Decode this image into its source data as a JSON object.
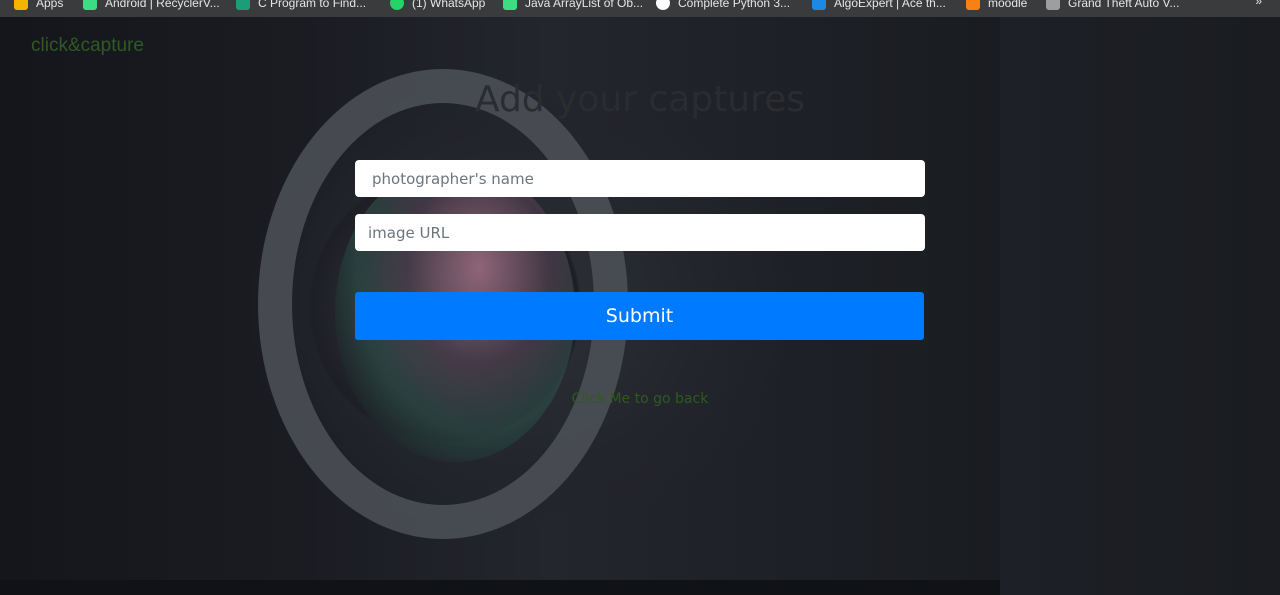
{
  "bookmarks": {
    "items": [
      {
        "label": "Apps",
        "icon": "apps-grid-icon",
        "color": "#f4b400"
      },
      {
        "label": "Android | RecyclerV...",
        "icon": "android-icon",
        "color": "#3ddc84"
      },
      {
        "label": "C Program to Find...",
        "icon": "site-icon",
        "color": "#1b9e77"
      },
      {
        "label": "(1) WhatsApp",
        "icon": "whatsapp-icon",
        "color": "#25d366"
      },
      {
        "label": "Java ArrayList of Ob...",
        "icon": "android-icon",
        "color": "#3ddc84"
      },
      {
        "label": "Complete Python 3...",
        "icon": "github-icon",
        "color": "#ffffff"
      },
      {
        "label": "AlgoExpert | Ace th...",
        "icon": "algoexpert-icon",
        "color": "#1e88e5"
      },
      {
        "label": "moodle",
        "icon": "moodle-icon",
        "color": "#f98012"
      },
      {
        "label": "Grand Theft Auto V...",
        "icon": "gta-icon",
        "color": "#9e9e9e"
      }
    ],
    "more": "»"
  },
  "brand": "click&capture",
  "heading": "Add your captures",
  "form": {
    "name_placeholder": "photographer's name",
    "name_value": "",
    "url_placeholder": "image URL",
    "url_value": "",
    "submit_label": "Submit"
  },
  "back_link": "Click Me to go back",
  "colors": {
    "accent": "#007bff",
    "brand_text": "#2f5a24",
    "link_text": "#2f5a1f"
  }
}
